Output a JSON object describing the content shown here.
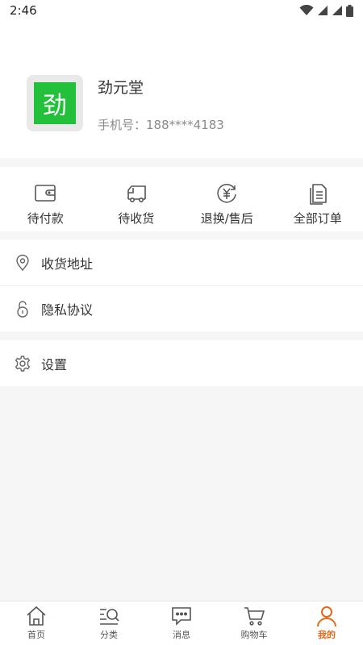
{
  "status_bar": {
    "time": "2:46"
  },
  "profile": {
    "avatar_char": "劲",
    "name": "劲元堂",
    "phone": "手机号：188****4183"
  },
  "orders": [
    {
      "label": "待付款",
      "icon": "wallet-icon"
    },
    {
      "label": "待收货",
      "icon": "truck-icon"
    },
    {
      "label": "退换/售后",
      "icon": "yuan-return-icon"
    },
    {
      "label": "全部订单",
      "icon": "document-list-icon"
    }
  ],
  "menu": {
    "address": "收货地址",
    "privacy": "隐私协议",
    "settings": "设置"
  },
  "tabs": [
    {
      "label": "首页",
      "icon": "home-icon"
    },
    {
      "label": "分类",
      "icon": "category-search-icon"
    },
    {
      "label": "消息",
      "icon": "message-icon"
    },
    {
      "label": "购物车",
      "icon": "cart-icon"
    },
    {
      "label": "我的",
      "icon": "user-icon",
      "active": true
    }
  ],
  "colors": {
    "accent": "#e06a1b",
    "avatar_bg": "#23c03c"
  }
}
